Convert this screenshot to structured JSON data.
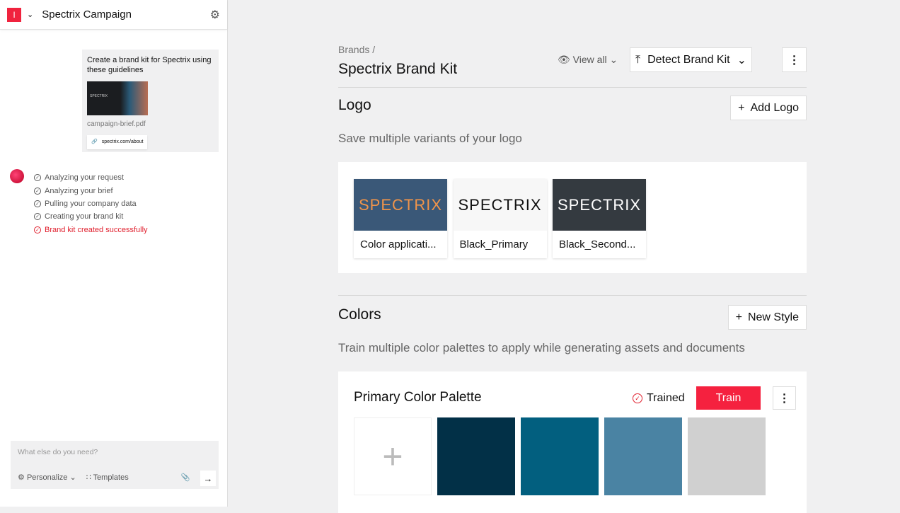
{
  "sidebar": {
    "logo": "I",
    "project": "Spectrix Campaign",
    "message": {
      "text": "Create a brand kit for Spectrix using these guidelines",
      "thumb_text": "SPECTRIX",
      "file": "campaign-brief.pdf",
      "link": "spectrix.com/about"
    },
    "steps": [
      {
        "label": "Analyzing your request"
      },
      {
        "label": "Analyzing your brief"
      },
      {
        "label": "Pulling your company data"
      },
      {
        "label": "Creating your brand kit"
      },
      {
        "label": "Brand kit created successfully"
      }
    ],
    "input": {
      "placeholder": "What else do you need?",
      "personalize": "Personalize",
      "templates": "Templates"
    }
  },
  "main": {
    "breadcrumb": "Brands /",
    "title": "Spectrix Brand Kit",
    "view_all": "View all",
    "detect": "Detect Brand Kit",
    "logo": {
      "heading": "Logo",
      "add": "Add Logo",
      "subtitle": "Save multiple variants of your logo",
      "items": [
        {
          "wordmark": "SPECTRIX",
          "label": "Color applicati...",
          "bg": "#3a5878",
          "fg": "#f0944a"
        },
        {
          "wordmark": "SPECTRIX",
          "label": "Black_Primary",
          "bg": "#f7f7f7",
          "fg": "#111111"
        },
        {
          "wordmark": "SPECTRIX",
          "label": "Black_Second...",
          "bg": "#343a40",
          "fg": "#ffffff"
        }
      ]
    },
    "colors": {
      "heading": "Colors",
      "add": "New Style",
      "subtitle": "Train multiple color palettes to apply while generating assets and documents",
      "palette": {
        "title": "Primary Color Palette",
        "status": "Trained",
        "train": "Train",
        "swatches": [
          "#023047",
          "#025f7f",
          "#4a83a3",
          "#d0d0d0"
        ]
      }
    }
  }
}
